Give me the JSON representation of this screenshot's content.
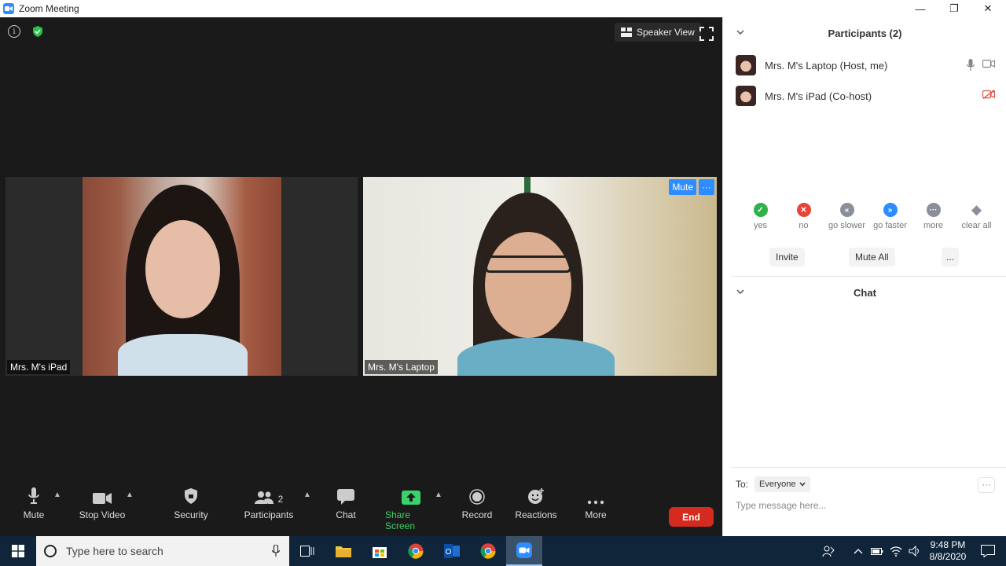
{
  "window": {
    "title": "Zoom Meeting",
    "controls": [
      "—",
      "❐",
      "✕"
    ]
  },
  "meeting": {
    "view_button": "Speaker View",
    "tiles": [
      {
        "name": "Mrs. M's iPad"
      },
      {
        "name": "Mrs. M's Laptop",
        "mute_label": "Mute",
        "more_label": "···"
      }
    ]
  },
  "toolbar": {
    "mute": "Mute",
    "stop_video": "Stop Video",
    "security": "Security",
    "participants": "Participants",
    "participants_count": "2",
    "chat": "Chat",
    "share_screen": "Share Screen",
    "record": "Record",
    "reactions": "Reactions",
    "more": "More",
    "end": "End",
    "share_color": "#3ad26a",
    "end_color": "#d52b1e"
  },
  "participants": {
    "header": "Participants (2)",
    "list": [
      {
        "name": "Mrs. M's Laptop (Host, me)"
      },
      {
        "name": "Mrs. M's iPad (Co-host)"
      }
    ],
    "feedback": [
      {
        "label": "yes",
        "symbol": "✓",
        "color": "#2fb24c"
      },
      {
        "label": "no",
        "symbol": "✕",
        "color": "#e8443a"
      },
      {
        "label": "go slower",
        "symbol": "«",
        "color": "#8a8f99"
      },
      {
        "label": "go faster",
        "symbol": "»",
        "color": "#2d8cff"
      },
      {
        "label": "more",
        "symbol": "···",
        "color": "#8a8f99"
      },
      {
        "label": "clear all",
        "symbol": "◆",
        "color": "#8a8f99"
      }
    ],
    "invite": "Invite",
    "mute_all": "Mute All",
    "more": "..."
  },
  "chat": {
    "header": "Chat",
    "to_label": "To:",
    "recipient": "Everyone",
    "more": "···",
    "placeholder": "Type message here..."
  },
  "taskbar": {
    "search_placeholder": "Type here to search",
    "time": "9:48 PM",
    "date": "8/8/2020"
  }
}
